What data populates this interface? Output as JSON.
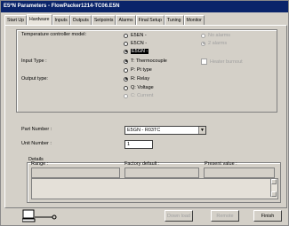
{
  "title": "E5*N Parameters - FlowPacker1214-TC06.E5N",
  "tabs": [
    "Start Up",
    "Hardware",
    "Inputs",
    "Outputs",
    "Setpoints",
    "Alarms",
    "Final Setup",
    "Tuning",
    "Monitor"
  ],
  "active_tab": "Hardware",
  "hardware": {
    "temp_model_label": "Temperature controller model:",
    "models": [
      "E5EN -",
      "E5CN -",
      "E5GN -"
    ],
    "selected_model": "E5GN -",
    "alarms_options": [
      "No alarms",
      "2 alarms"
    ],
    "input_type_label": "Input Type :",
    "input_options": [
      "T: Thermocouple",
      "P: Pt type"
    ],
    "heater_burnout_label": "Heater burnout",
    "output_type_label": "Output type:",
    "output_options": [
      "R: Relay",
      "Q: Voltage",
      "C: Current"
    ]
  },
  "part_number_label": "Part Number :",
  "part_number_value": "E5GN - R03TC",
  "unit_number_label": "Unit Number :",
  "unit_number_value": "1",
  "details": {
    "label": "Details",
    "range_label": "Range :",
    "factory_default_label": "Factory default :",
    "present_value_label": "Present value :"
  },
  "buttons": {
    "download": "Down load",
    "remote": "Remote",
    "finish": "Finish"
  },
  "colors": {
    "titlebar": "#0a246a",
    "window": "#d4d0c8",
    "disabled_text": "#a0a0a0"
  }
}
